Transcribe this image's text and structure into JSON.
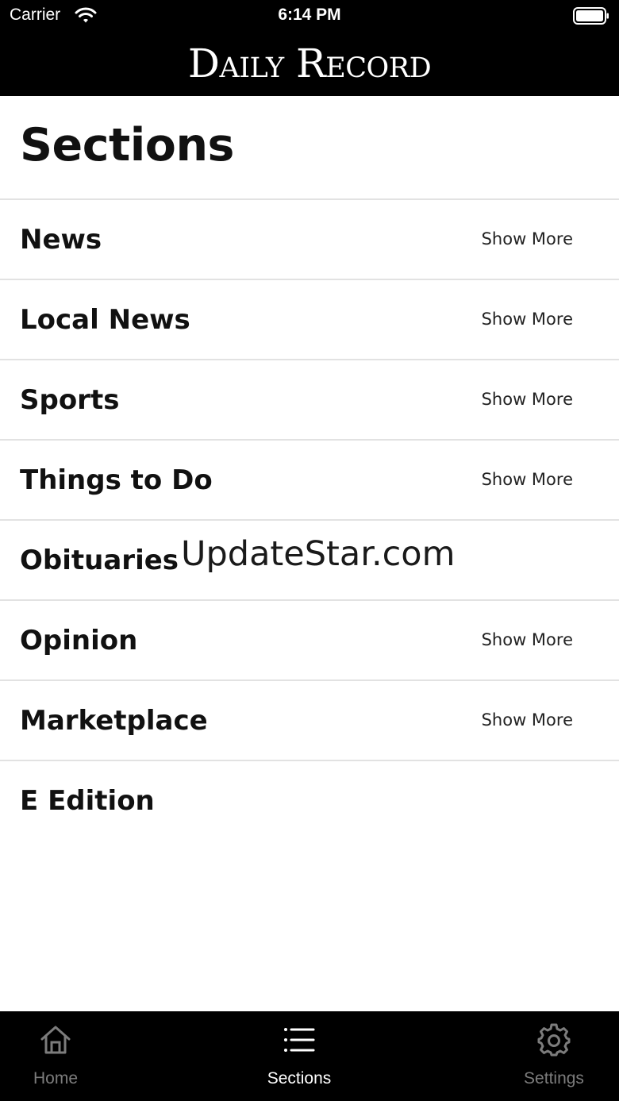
{
  "status_bar": {
    "carrier": "Carrier",
    "time": "6:14 PM"
  },
  "header": {
    "masthead": "Daily Record"
  },
  "page": {
    "title": "Sections"
  },
  "sections": [
    {
      "label": "News",
      "action": "Show More"
    },
    {
      "label": "Local News",
      "action": "Show More"
    },
    {
      "label": "Sports",
      "action": "Show More"
    },
    {
      "label": "Things to Do",
      "action": "Show More"
    },
    {
      "label": "Obituaries",
      "action": ""
    },
    {
      "label": "Opinion",
      "action": "Show More"
    },
    {
      "label": "Marketplace",
      "action": "Show More"
    },
    {
      "label": "E Edition",
      "action": ""
    }
  ],
  "watermark": "UpdateStar.com",
  "tabs": [
    {
      "label": "Home",
      "icon": "home-icon",
      "state": "inactive"
    },
    {
      "label": "Sections",
      "icon": "list-icon",
      "state": "active"
    },
    {
      "label": "Settings",
      "icon": "gear-icon",
      "state": "inactive"
    }
  ],
  "colors": {
    "bar_background": "#000000",
    "active_tab": "#ffffff",
    "inactive_tab": "#7c7c7c",
    "divider": "#e2e2e2"
  }
}
